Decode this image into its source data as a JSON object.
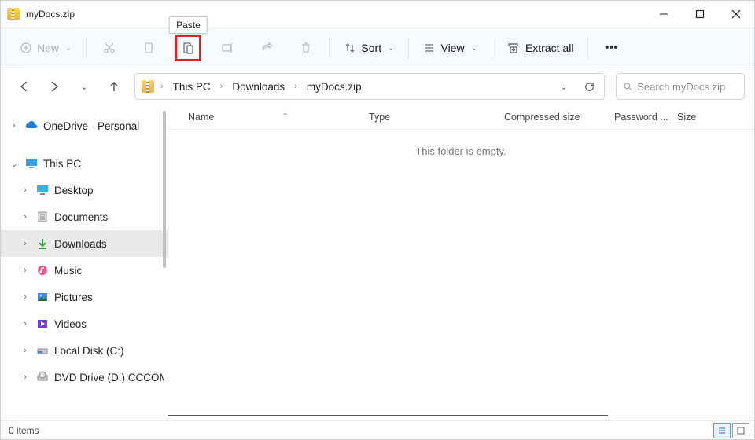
{
  "window": {
    "title": "myDocs.zip"
  },
  "tooltip": {
    "paste": "Paste"
  },
  "toolbar": {
    "new_label": "New",
    "sort_label": "Sort",
    "view_label": "View",
    "extract_label": "Extract all"
  },
  "breadcrumbs": {
    "pc": "This PC",
    "folder": "Downloads",
    "file": "myDocs.zip"
  },
  "search": {
    "placeholder": "Search myDocs.zip"
  },
  "columns": {
    "name": "Name",
    "type": "Type",
    "compressed": "Compressed size",
    "password": "Password ...",
    "size": "Size"
  },
  "content": {
    "empty": "This folder is empty."
  },
  "sidebar": {
    "items": [
      {
        "label": "OneDrive - Personal"
      },
      {
        "label": "This PC"
      },
      {
        "label": "Desktop"
      },
      {
        "label": "Documents"
      },
      {
        "label": "Downloads"
      },
      {
        "label": "Music"
      },
      {
        "label": "Pictures"
      },
      {
        "label": "Videos"
      },
      {
        "label": "Local Disk (C:)"
      },
      {
        "label": "DVD Drive (D:) CCCOM"
      }
    ]
  },
  "status": {
    "text": "0 items"
  }
}
